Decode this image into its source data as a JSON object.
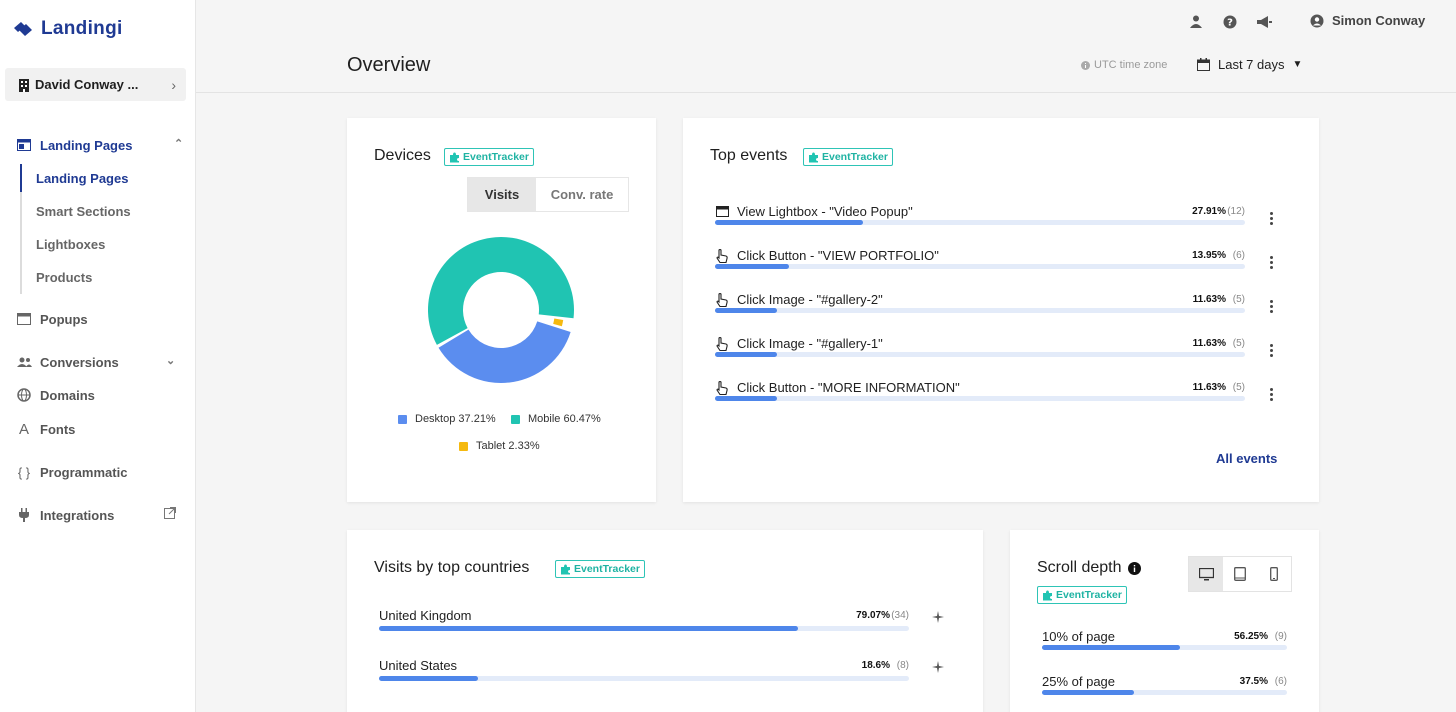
{
  "app": {
    "logo_text": "Landingi",
    "brand_color": "#1f3a93",
    "accent_color": "#2ec4b6",
    "bar_color": "#4e86ea"
  },
  "sidebar": {
    "account": "David Conway ...",
    "items": [
      {
        "label": "Landing Pages",
        "icon": "page-icon"
      },
      {
        "label": "Popups",
        "icon": "popup-icon"
      },
      {
        "label": "Conversions",
        "icon": "people-icon"
      },
      {
        "label": "Domains",
        "icon": "globe-icon"
      },
      {
        "label": "Fonts",
        "icon": "font-icon"
      },
      {
        "label": "Programmatic",
        "icon": "braces-icon"
      },
      {
        "label": "Integrations",
        "icon": "plug-icon"
      }
    ],
    "sub_items": [
      "Landing Pages",
      "Smart Sections",
      "Lightboxes",
      "Products"
    ]
  },
  "topbar": {
    "user_name": "Simon Conway"
  },
  "header": {
    "title": "Overview",
    "timezone": "UTC time zone",
    "range": "Last 7 days"
  },
  "badge_label": "EventTracker",
  "devices": {
    "title": "Devices",
    "tabs": [
      "Visits",
      "Conv. rate"
    ],
    "legend": [
      "Desktop 37.21%",
      "Mobile 60.47%",
      "Tablet 2.33%"
    ]
  },
  "chart_data": {
    "type": "pie",
    "categories": [
      "Desktop",
      "Mobile",
      "Tablet"
    ],
    "values": [
      37.21,
      60.47,
      2.33
    ],
    "colors": [
      "#5b8def",
      "#20c4b2",
      "#f5b90f"
    ]
  },
  "top_events": {
    "title": "Top events",
    "all_label": "All events",
    "rows": [
      {
        "label": "View Lightbox - \"Video Popup\"",
        "pct": "27.91%",
        "count": "(12)",
        "value": 27.91,
        "icon": "window-icon"
      },
      {
        "label": "Click Button - \"VIEW PORTFOLIO\"",
        "pct": "13.95%",
        "count": "(6)",
        "value": 13.95,
        "icon": "pointer-icon"
      },
      {
        "label": "Click Image - \"#gallery-2\"",
        "pct": "11.63%",
        "count": "(5)",
        "value": 11.63,
        "icon": "pointer-icon"
      },
      {
        "label": "Click Image - \"#gallery-1\"",
        "pct": "11.63%",
        "count": "(5)",
        "value": 11.63,
        "icon": "pointer-icon"
      },
      {
        "label": "Click Button - \"MORE INFORMATION\"",
        "pct": "11.63%",
        "count": "(5)",
        "value": 11.63,
        "icon": "pointer-icon"
      }
    ]
  },
  "countries": {
    "title": "Visits by top countries",
    "rows": [
      {
        "label": "United Kingdom",
        "pct": "79.07%",
        "count": "(34)",
        "value": 79.07
      },
      {
        "label": "United States",
        "pct": "18.6%",
        "count": "(8)",
        "value": 18.6
      }
    ]
  },
  "scroll": {
    "title": "Scroll depth",
    "rows": [
      {
        "label": "10% of page",
        "pct": "56.25%",
        "count": "(9)",
        "value": 56.25
      },
      {
        "label": "25% of page",
        "pct": "37.5%",
        "count": "(6)",
        "value": 37.5
      }
    ]
  }
}
